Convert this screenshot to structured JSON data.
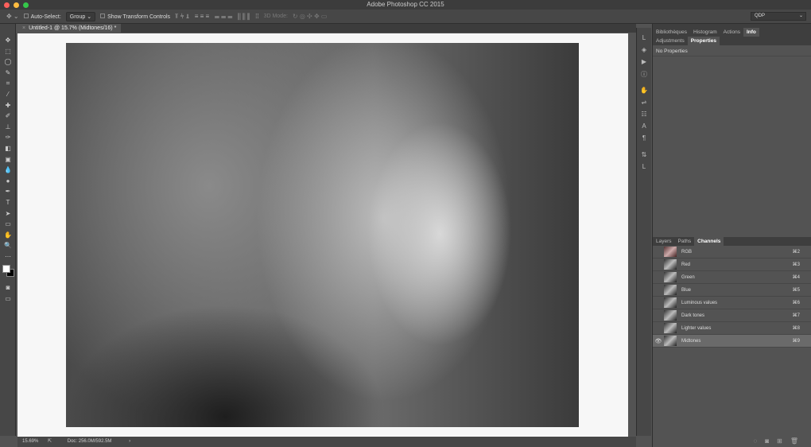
{
  "app_title": "Adobe Photoshop CC 2015",
  "options": {
    "auto_select_label": "Auto-Select:",
    "auto_select_value": "Group",
    "show_transform_label": "Show Transform Controls",
    "mode_3d_label": "3D Mode:",
    "workspace": "QDP"
  },
  "document_tab": "Untitled-1 @ 15.7% (Midtones/16) *",
  "status": {
    "zoom": "15.69%",
    "doc": "Doc: 256.0M/592.5M"
  },
  "top_panel": {
    "tabs_row1": [
      "Bibliothèques",
      "Histogram",
      "Actions",
      "Info"
    ],
    "tabs_row2": [
      "Adjustments",
      "Properties"
    ],
    "content": "No Properties"
  },
  "channels_panel": {
    "tabs": [
      "Layers",
      "Paths",
      "Channels"
    ],
    "channels": [
      {
        "name": "RGB",
        "shortcut": "⌘2",
        "visible": false
      },
      {
        "name": "Red",
        "shortcut": "⌘3",
        "visible": false
      },
      {
        "name": "Green",
        "shortcut": "⌘4",
        "visible": false
      },
      {
        "name": "Blue",
        "shortcut": "⌘5",
        "visible": false
      },
      {
        "name": "Luminous values",
        "shortcut": "⌘6",
        "visible": false
      },
      {
        "name": "Dark tones",
        "shortcut": "⌘7",
        "visible": false
      },
      {
        "name": "Lighter values",
        "shortcut": "⌘8",
        "visible": false
      },
      {
        "name": "Midtones",
        "shortcut": "⌘9",
        "visible": true
      }
    ]
  }
}
